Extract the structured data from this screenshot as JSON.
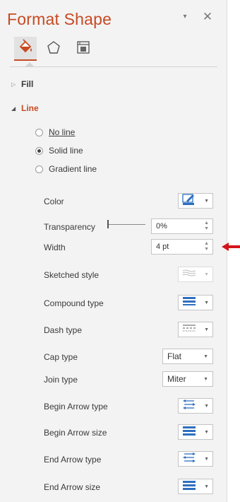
{
  "panel": {
    "title": "Format Shape",
    "dropdown_glyph": "▾",
    "close_glyph": "✕"
  },
  "tabs": [
    {
      "name": "fill-line-tab",
      "icon": "paint-bucket-icon",
      "active": true
    },
    {
      "name": "effects-tab",
      "icon": "pentagon-icon",
      "active": false
    },
    {
      "name": "size-properties-tab",
      "icon": "size-properties-icon",
      "active": false
    }
  ],
  "sections": {
    "fill": {
      "label": "Fill",
      "expanded": false,
      "glyph": "▷"
    },
    "line": {
      "label": "Line",
      "expanded": true,
      "glyph": "◢"
    }
  },
  "line_type": {
    "options": [
      "No line",
      "Solid line",
      "Gradient line"
    ],
    "selected": "Solid line"
  },
  "properties": {
    "color": {
      "label": "Color"
    },
    "transparency": {
      "label": "Transparency",
      "value": "0%"
    },
    "width": {
      "label": "Width",
      "value": "4 pt"
    },
    "sketched_style": {
      "label": "Sketched style",
      "enabled": false
    },
    "compound_type": {
      "label": "Compound type"
    },
    "dash_type": {
      "label": "Dash type"
    },
    "cap_type": {
      "label": "Cap type",
      "value": "Flat"
    },
    "join_type": {
      "label": "Join type",
      "value": "Miter"
    },
    "begin_arrow_type": {
      "label": "Begin Arrow type"
    },
    "begin_arrow_size": {
      "label": "Begin Arrow size"
    },
    "end_arrow_type": {
      "label": "End Arrow type"
    },
    "end_arrow_size": {
      "label": "End Arrow size"
    }
  },
  "colors": {
    "accent": "#c74a22",
    "icon_blue": "#2f6fc0",
    "callout_red": "#d4151b",
    "pane_bg": "#f3f3f3"
  }
}
